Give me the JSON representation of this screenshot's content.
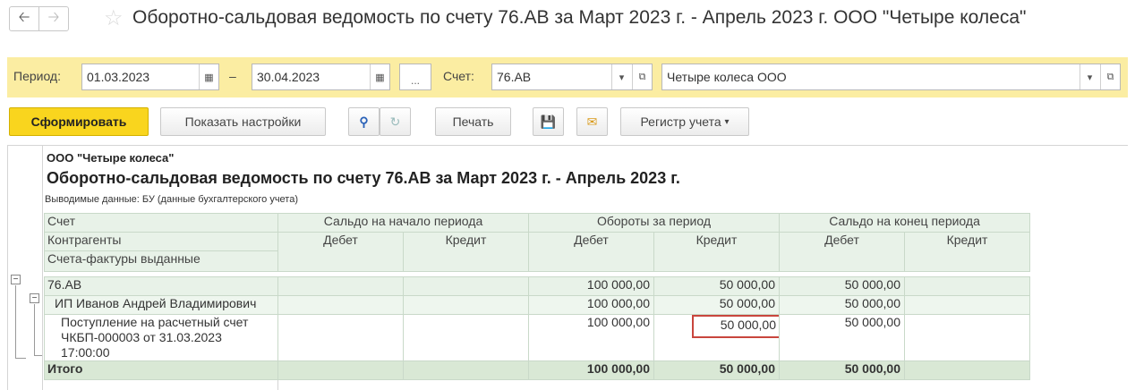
{
  "window": {
    "title": "Оборотно-сальдовая ведомость по счету 76.АВ за Март 2023 г. - Апрель 2023 г. ООО \"Четыре колеса\""
  },
  "params": {
    "period_label": "Период:",
    "date_from": "01.03.2023",
    "dash": "–",
    "date_to": "30.04.2023",
    "dots": "...",
    "account_label": "Счет:",
    "account": "76.АВ",
    "organization": "Четыре колеса ООО"
  },
  "commands": {
    "generate": "Сформировать",
    "show_settings": "Показать настройки",
    "print": "Печать",
    "register": "Регистр учета"
  },
  "report": {
    "org": "ООО \"Четыре колеса\"",
    "title": "Оборотно-сальдовая ведомость по счету 76.АВ за Март 2023 г. - Апрель 2023 г.",
    "note": "Выводимые данные:  БУ (данные бухгалтерского учета)",
    "headers": {
      "col1_row1": "Счет",
      "col1_row2": "Контрагенты",
      "col1_row3": "Счета-фактуры выданные",
      "opening": "Сальдо на начало периода",
      "turnover": "Обороты за период",
      "closing": "Сальдо на конец периода",
      "debit": "Дебет",
      "credit": "Кредит"
    },
    "rows": [
      {
        "name": "76.АВ",
        "open_dt": "",
        "open_kt": "",
        "turn_dt": "100 000,00",
        "turn_kt": "50 000,00",
        "close_dt": "50 000,00",
        "close_kt": ""
      },
      {
        "name": "ИП Иванов Андрей Владимирович",
        "open_dt": "",
        "open_kt": "",
        "turn_dt": "100 000,00",
        "turn_kt": "50 000,00",
        "close_dt": "50 000,00",
        "close_kt": ""
      },
      {
        "name_line1": "Поступление на расчетный счет",
        "name_line2": "ЧКБП-000003 от 31.03.2023",
        "name_line3": "17:00:00",
        "open_dt": "",
        "open_kt": "",
        "turn_dt": "100 000,00",
        "turn_kt": "50 000,00",
        "close_dt": "50 000,00",
        "close_kt": ""
      }
    ],
    "total": {
      "name": "Итого",
      "turn_dt": "100 000,00",
      "turn_kt": "50 000,00",
      "close_dt": "50 000,00"
    }
  }
}
